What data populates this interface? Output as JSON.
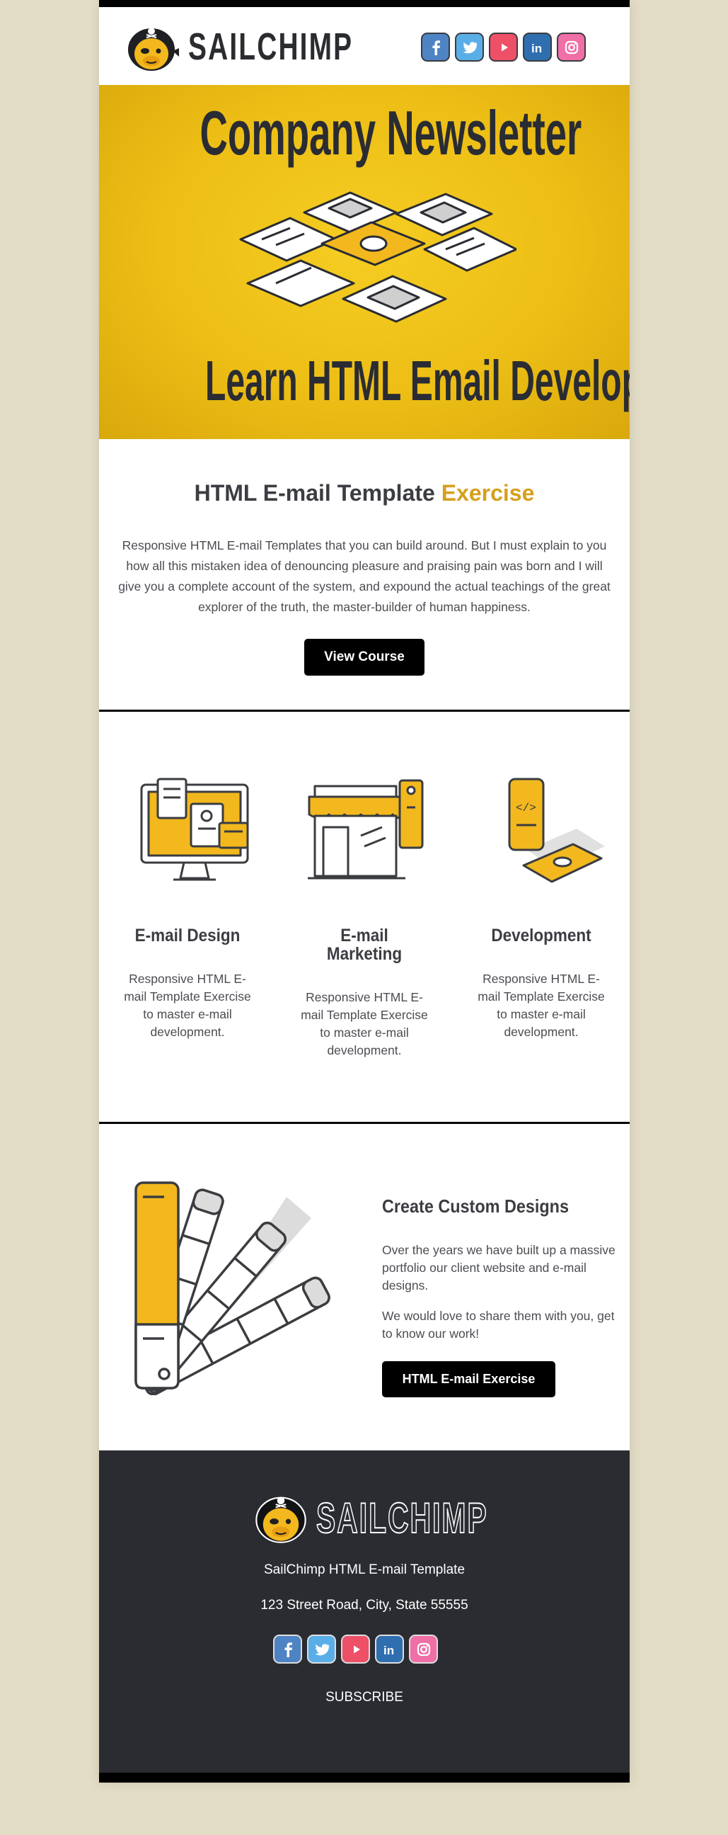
{
  "brand": {
    "name": "SAILCHIMP"
  },
  "social": [
    {
      "icon": "facebook-icon",
      "glyph": "f",
      "color": "#4f84c4"
    },
    {
      "icon": "twitter-icon",
      "glyph": "t",
      "color": "#5aaee8"
    },
    {
      "icon": "youtube-icon",
      "glyph": "y",
      "color": "#ee5067"
    },
    {
      "icon": "linkedin-icon",
      "glyph": "in",
      "color": "#2f6fb0"
    },
    {
      "icon": "instagram-icon",
      "glyph": "i",
      "color": "#ef6fa6"
    }
  ],
  "hero": {
    "title": "Company Newsletter",
    "subtitle": "Learn HTML Email Development!"
  },
  "intro": {
    "title_main": "HTML E-mail Template",
    "title_accent": "Exercise",
    "body": "Responsive HTML E-mail Templates that you can build around. But I must explain to you how all this mistaken idea of denouncing pleasure and praising pain was born and I will give you a complete account of the system, and expound the actual teachings of the great explorer of the truth, the master-builder of human happiness.",
    "button": "View Course"
  },
  "features": [
    {
      "title": "E-mail Design",
      "text": "Responsive HTML E-mail Template Exercise to master e-mail development."
    },
    {
      "title": "E-mail Marketing",
      "text": "Responsive HTML E-mail Template Exercise to master e-mail development."
    },
    {
      "title": "Development",
      "text": "Responsive HTML E-mail Template Exercise to master e-mail development."
    }
  ],
  "custom": {
    "title": "Create Custom Designs",
    "p1": "Over the years we have built up a massive portfolio our client website and e-mail designs.",
    "p2": "We would love to share them with you, get to know our work!",
    "button": "HTML E-mail Exercise"
  },
  "footer": {
    "template_name": "SailChimp HTML E-mail Template",
    "address": "123 Street Road, City, State 55555",
    "subscribe": "SUBSCRIBE"
  },
  "colors": {
    "page_bg": "#e4ddc6",
    "hero_yellow": "#f0c419",
    "accent": "#d6a01c",
    "dark": "#2a2c31"
  }
}
